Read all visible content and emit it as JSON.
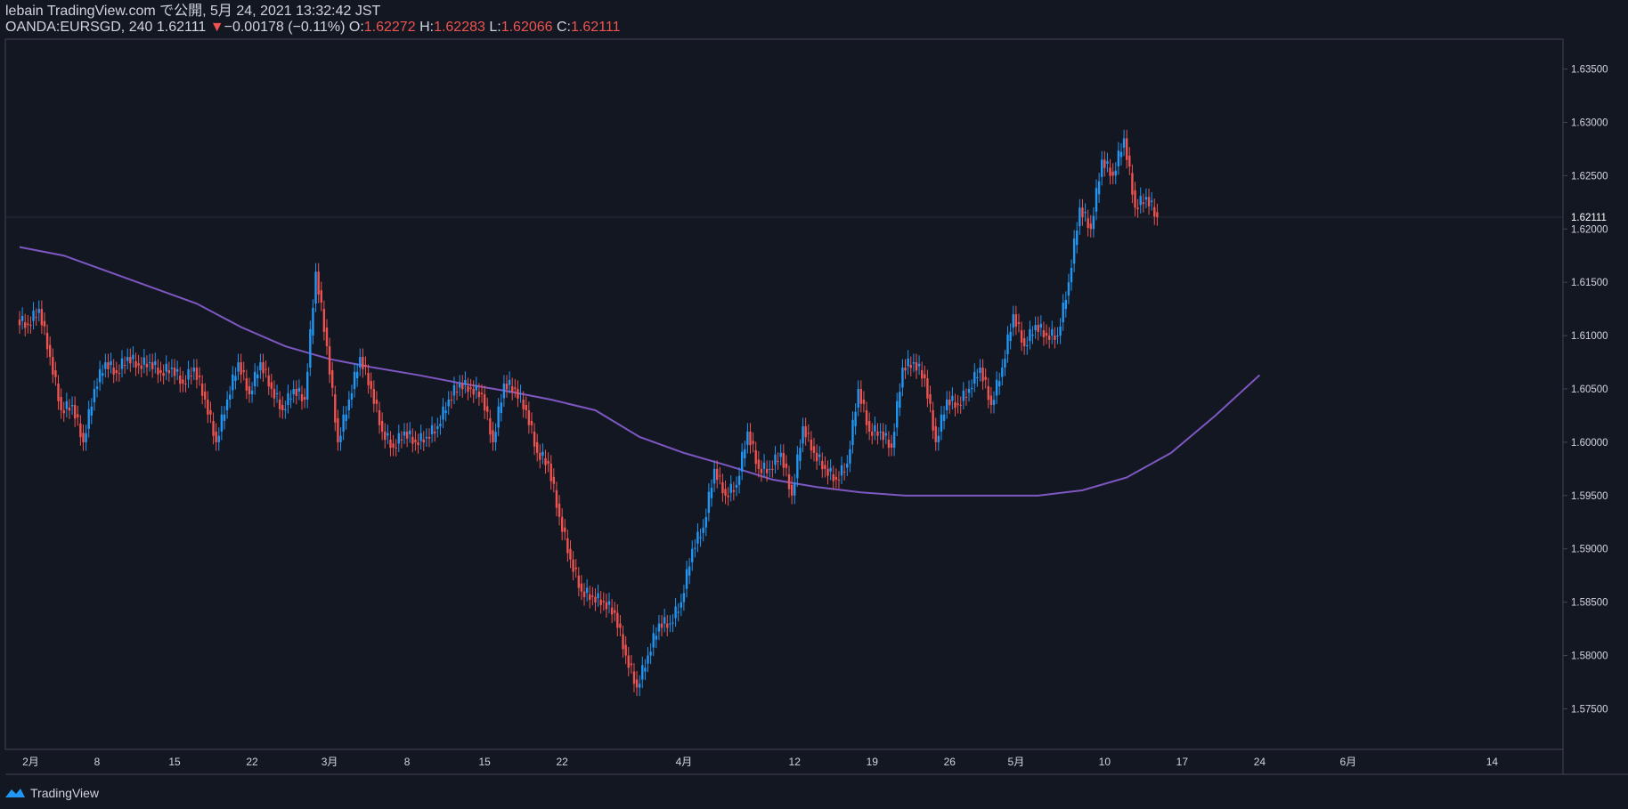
{
  "header": {
    "publish_line": "lebain TradingView.com で公開, 5月 24, 2021 13:32:42 JST",
    "symbol": "OANDA:EURSGD, 240",
    "last": "1.62111",
    "change": "−0.00178 (−0.11%)",
    "o_label": "O:",
    "o": "1.62272",
    "h_label": "H:",
    "h": "1.62283",
    "l_label": "L:",
    "l": "1.62066",
    "c_label": "C:",
    "c": "1.62111"
  },
  "footer": {
    "brand": "TradingView"
  },
  "colors": {
    "background": "#131722",
    "up": "#2196f3",
    "down": "#ef5350",
    "ma": "#7e57c2",
    "axis_text": "#d1d4dc",
    "border": "#434651"
  },
  "chart_data": {
    "type": "line",
    "title": "OANDA:EURSGD, 240",
    "ylim": [
      1.5712,
      1.6378
    ],
    "y_ticks": [
      "1.63500",
      "1.63000",
      "1.62500",
      "1.62000",
      "1.61500",
      "1.61000",
      "1.60500",
      "1.60000",
      "1.59500",
      "1.59000",
      "1.58500",
      "1.58000",
      "1.57500"
    ],
    "last_price_label": "1.62111",
    "x_ticks": [
      {
        "label": "2月",
        "day": 1
      },
      {
        "label": "8",
        "day": 7
      },
      {
        "label": "15",
        "day": 14
      },
      {
        "label": "22",
        "day": 21
      },
      {
        "label": "3月",
        "day": 28
      },
      {
        "label": "8",
        "day": 35
      },
      {
        "label": "15",
        "day": 42
      },
      {
        "label": "22",
        "day": 49
      },
      {
        "label": "4月",
        "day": 60
      },
      {
        "label": "12",
        "day": 70
      },
      {
        "label": "19",
        "day": 77
      },
      {
        "label": "26",
        "day": 84
      },
      {
        "label": "5月",
        "day": 90
      },
      {
        "label": "10",
        "day": 98
      },
      {
        "label": "17",
        "day": 105
      },
      {
        "label": "24",
        "day": 112
      },
      {
        "label": "6月",
        "day": 120
      },
      {
        "label": "14",
        "day": 133
      }
    ],
    "xlim": [
      0,
      139.4
    ],
    "series": [
      {
        "kind": "candles",
        "x": [
          0,
          1,
          2,
          3,
          4,
          5,
          6,
          7,
          8,
          9,
          10,
          11,
          12,
          13,
          14,
          15,
          16,
          17,
          18,
          19,
          20,
          21,
          22,
          23,
          24,
          25,
          26,
          27,
          28,
          29,
          30,
          31,
          32,
          33,
          34,
          35,
          36,
          37,
          38,
          39,
          40,
          41,
          42,
          43,
          44,
          45,
          46,
          47,
          48,
          49,
          50,
          51,
          52,
          53,
          54,
          55,
          56,
          57,
          58,
          59,
          60,
          61,
          62,
          63,
          64,
          65,
          66,
          67,
          68,
          69,
          70,
          71,
          72,
          73,
          74,
          75,
          76,
          77,
          78,
          79,
          80,
          81,
          82,
          83,
          84,
          85,
          86,
          87,
          88,
          89,
          90,
          91,
          92,
          93,
          94,
          95,
          96,
          97,
          98,
          99,
          100,
          101,
          102,
          103,
          104,
          105,
          106,
          107,
          108,
          109,
          110,
          111,
          112
        ],
        "close": [
          1.611,
          1.6125,
          1.608,
          1.603,
          1.6035,
          1.6,
          1.605,
          1.6075,
          1.6065,
          1.608,
          1.6072,
          1.6075,
          1.6065,
          1.607,
          1.6055,
          1.607,
          1.604,
          1.6,
          1.604,
          1.6075,
          1.6045,
          1.6075,
          1.605,
          1.603,
          1.605,
          1.604,
          1.616,
          1.609,
          1.6,
          1.604,
          1.608,
          1.605,
          1.601,
          1.5995,
          1.601,
          1.6,
          1.6005,
          1.6015,
          1.604,
          1.6055,
          1.605,
          1.6045,
          1.6,
          1.6055,
          1.605,
          1.603,
          1.599,
          1.598,
          1.593,
          1.589,
          1.586,
          1.5855,
          1.585,
          1.584,
          1.58,
          1.577,
          1.58,
          1.583,
          1.583,
          1.585,
          1.59,
          1.592,
          1.5975,
          1.595,
          1.596,
          1.601,
          1.5975,
          1.5975,
          1.599,
          1.595,
          1.6015,
          1.599,
          1.5975,
          1.5965,
          1.598,
          1.605,
          1.601,
          1.601,
          1.5995,
          1.607,
          1.6075,
          1.606,
          1.6,
          1.604,
          1.6035,
          1.605,
          1.607,
          1.6035,
          1.607,
          1.612,
          1.609,
          1.611,
          1.61,
          1.61,
          1.615,
          1.622,
          1.62,
          1.6265,
          1.625,
          1.6285,
          1.622,
          1.623,
          1.6211
        ],
        "open": null
      },
      {
        "kind": "ma",
        "name": "",
        "x": [
          0,
          4,
          8,
          12,
          16,
          20,
          24,
          28,
          32,
          36,
          40,
          44,
          48,
          52,
          56,
          60,
          64,
          68,
          72,
          76,
          80,
          84,
          88,
          92,
          96,
          100,
          104,
          108,
          112
        ],
        "values": [
          1.6183,
          1.6175,
          1.616,
          1.6145,
          1.613,
          1.6108,
          1.609,
          1.6078,
          1.607,
          1.6063,
          1.6055,
          1.6048,
          1.604,
          1.603,
          1.6005,
          1.599,
          1.5978,
          1.5965,
          1.5958,
          1.5953,
          1.595,
          1.595,
          1.595,
          1.595,
          1.5955,
          1.5967,
          1.599,
          1.6025,
          1.6063
        ]
      }
    ]
  }
}
